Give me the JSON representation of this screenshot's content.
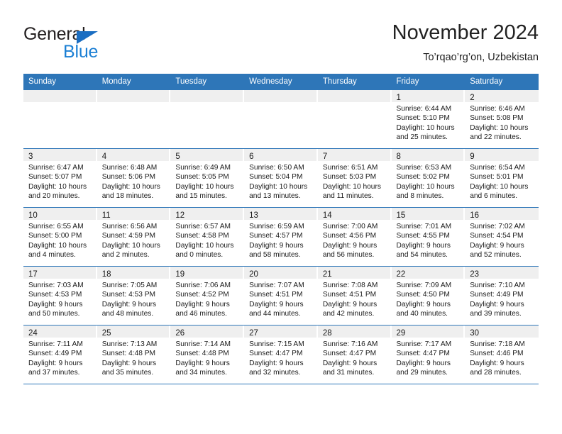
{
  "brand": {
    "name_top": "General",
    "name_bottom": "Blue",
    "triangle_color": "#1b6ec2",
    "blue_color": "#1b7fd4"
  },
  "header": {
    "title": "November 2024",
    "subtitle": "To’rqao’rg’on, Uzbekistan",
    "accent_color": "#2e76b8",
    "daynum_band_color": "#efefef"
  },
  "weekday_headers": [
    "Sunday",
    "Monday",
    "Tuesday",
    "Wednesday",
    "Thursday",
    "Friday",
    "Saturday"
  ],
  "labels": {
    "sunrise_prefix": "Sunrise:",
    "sunset_prefix": "Sunset:",
    "daylight_prefix": "Daylight:"
  },
  "weeks": [
    [
      {
        "day": "",
        "empty": true
      },
      {
        "day": "",
        "empty": true
      },
      {
        "day": "",
        "empty": true
      },
      {
        "day": "",
        "empty": true
      },
      {
        "day": "",
        "empty": true
      },
      {
        "day": "1",
        "sunrise": "Sunrise: 6:44 AM",
        "sunset": "Sunset: 5:10 PM",
        "daylight_line1": "Daylight: 10 hours",
        "daylight_line2": "and 25 minutes."
      },
      {
        "day": "2",
        "sunrise": "Sunrise: 6:46 AM",
        "sunset": "Sunset: 5:08 PM",
        "daylight_line1": "Daylight: 10 hours",
        "daylight_line2": "and 22 minutes."
      }
    ],
    [
      {
        "day": "3",
        "sunrise": "Sunrise: 6:47 AM",
        "sunset": "Sunset: 5:07 PM",
        "daylight_line1": "Daylight: 10 hours",
        "daylight_line2": "and 20 minutes."
      },
      {
        "day": "4",
        "sunrise": "Sunrise: 6:48 AM",
        "sunset": "Sunset: 5:06 PM",
        "daylight_line1": "Daylight: 10 hours",
        "daylight_line2": "and 18 minutes."
      },
      {
        "day": "5",
        "sunrise": "Sunrise: 6:49 AM",
        "sunset": "Sunset: 5:05 PM",
        "daylight_line1": "Daylight: 10 hours",
        "daylight_line2": "and 15 minutes."
      },
      {
        "day": "6",
        "sunrise": "Sunrise: 6:50 AM",
        "sunset": "Sunset: 5:04 PM",
        "daylight_line1": "Daylight: 10 hours",
        "daylight_line2": "and 13 minutes."
      },
      {
        "day": "7",
        "sunrise": "Sunrise: 6:51 AM",
        "sunset": "Sunset: 5:03 PM",
        "daylight_line1": "Daylight: 10 hours",
        "daylight_line2": "and 11 minutes."
      },
      {
        "day": "8",
        "sunrise": "Sunrise: 6:53 AM",
        "sunset": "Sunset: 5:02 PM",
        "daylight_line1": "Daylight: 10 hours",
        "daylight_line2": "and 8 minutes."
      },
      {
        "day": "9",
        "sunrise": "Sunrise: 6:54 AM",
        "sunset": "Sunset: 5:01 PM",
        "daylight_line1": "Daylight: 10 hours",
        "daylight_line2": "and 6 minutes."
      }
    ],
    [
      {
        "day": "10",
        "sunrise": "Sunrise: 6:55 AM",
        "sunset": "Sunset: 5:00 PM",
        "daylight_line1": "Daylight: 10 hours",
        "daylight_line2": "and 4 minutes."
      },
      {
        "day": "11",
        "sunrise": "Sunrise: 6:56 AM",
        "sunset": "Sunset: 4:59 PM",
        "daylight_line1": "Daylight: 10 hours",
        "daylight_line2": "and 2 minutes."
      },
      {
        "day": "12",
        "sunrise": "Sunrise: 6:57 AM",
        "sunset": "Sunset: 4:58 PM",
        "daylight_line1": "Daylight: 10 hours",
        "daylight_line2": "and 0 minutes."
      },
      {
        "day": "13",
        "sunrise": "Sunrise: 6:59 AM",
        "sunset": "Sunset: 4:57 PM",
        "daylight_line1": "Daylight: 9 hours",
        "daylight_line2": "and 58 minutes."
      },
      {
        "day": "14",
        "sunrise": "Sunrise: 7:00 AM",
        "sunset": "Sunset: 4:56 PM",
        "daylight_line1": "Daylight: 9 hours",
        "daylight_line2": "and 56 minutes."
      },
      {
        "day": "15",
        "sunrise": "Sunrise: 7:01 AM",
        "sunset": "Sunset: 4:55 PM",
        "daylight_line1": "Daylight: 9 hours",
        "daylight_line2": "and 54 minutes."
      },
      {
        "day": "16",
        "sunrise": "Sunrise: 7:02 AM",
        "sunset": "Sunset: 4:54 PM",
        "daylight_line1": "Daylight: 9 hours",
        "daylight_line2": "and 52 minutes."
      }
    ],
    [
      {
        "day": "17",
        "sunrise": "Sunrise: 7:03 AM",
        "sunset": "Sunset: 4:53 PM",
        "daylight_line1": "Daylight: 9 hours",
        "daylight_line2": "and 50 minutes."
      },
      {
        "day": "18",
        "sunrise": "Sunrise: 7:05 AM",
        "sunset": "Sunset: 4:53 PM",
        "daylight_line1": "Daylight: 9 hours",
        "daylight_line2": "and 48 minutes."
      },
      {
        "day": "19",
        "sunrise": "Sunrise: 7:06 AM",
        "sunset": "Sunset: 4:52 PM",
        "daylight_line1": "Daylight: 9 hours",
        "daylight_line2": "and 46 minutes."
      },
      {
        "day": "20",
        "sunrise": "Sunrise: 7:07 AM",
        "sunset": "Sunset: 4:51 PM",
        "daylight_line1": "Daylight: 9 hours",
        "daylight_line2": "and 44 minutes."
      },
      {
        "day": "21",
        "sunrise": "Sunrise: 7:08 AM",
        "sunset": "Sunset: 4:51 PM",
        "daylight_line1": "Daylight: 9 hours",
        "daylight_line2": "and 42 minutes."
      },
      {
        "day": "22",
        "sunrise": "Sunrise: 7:09 AM",
        "sunset": "Sunset: 4:50 PM",
        "daylight_line1": "Daylight: 9 hours",
        "daylight_line2": "and 40 minutes."
      },
      {
        "day": "23",
        "sunrise": "Sunrise: 7:10 AM",
        "sunset": "Sunset: 4:49 PM",
        "daylight_line1": "Daylight: 9 hours",
        "daylight_line2": "and 39 minutes."
      }
    ],
    [
      {
        "day": "24",
        "sunrise": "Sunrise: 7:11 AM",
        "sunset": "Sunset: 4:49 PM",
        "daylight_line1": "Daylight: 9 hours",
        "daylight_line2": "and 37 minutes."
      },
      {
        "day": "25",
        "sunrise": "Sunrise: 7:13 AM",
        "sunset": "Sunset: 4:48 PM",
        "daylight_line1": "Daylight: 9 hours",
        "daylight_line2": "and 35 minutes."
      },
      {
        "day": "26",
        "sunrise": "Sunrise: 7:14 AM",
        "sunset": "Sunset: 4:48 PM",
        "daylight_line1": "Daylight: 9 hours",
        "daylight_line2": "and 34 minutes."
      },
      {
        "day": "27",
        "sunrise": "Sunrise: 7:15 AM",
        "sunset": "Sunset: 4:47 PM",
        "daylight_line1": "Daylight: 9 hours",
        "daylight_line2": "and 32 minutes."
      },
      {
        "day": "28",
        "sunrise": "Sunrise: 7:16 AM",
        "sunset": "Sunset: 4:47 PM",
        "daylight_line1": "Daylight: 9 hours",
        "daylight_line2": "and 31 minutes."
      },
      {
        "day": "29",
        "sunrise": "Sunrise: 7:17 AM",
        "sunset": "Sunset: 4:47 PM",
        "daylight_line1": "Daylight: 9 hours",
        "daylight_line2": "and 29 minutes."
      },
      {
        "day": "30",
        "sunrise": "Sunrise: 7:18 AM",
        "sunset": "Sunset: 4:46 PM",
        "daylight_line1": "Daylight: 9 hours",
        "daylight_line2": "and 28 minutes."
      }
    ]
  ]
}
